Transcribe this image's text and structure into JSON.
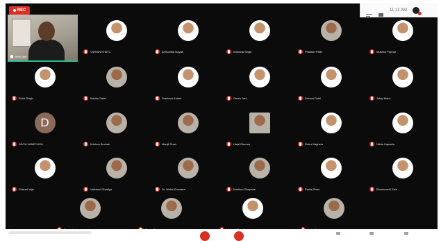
{
  "recording": {
    "label": "REC"
  },
  "header": {
    "time": "11:12 AM",
    "icons": [
      "people-icon",
      "chat-icon"
    ]
  },
  "self_view": {
    "name": "Vidhi Jain"
  },
  "participants": [
    {
      "name": "VIDHAN KHATC",
      "photo": "true"
    },
    {
      "name": "Aniruddha Nayak",
      "photo": "true"
    },
    {
      "name": "Archana Singh",
      "photo": "true"
    },
    {
      "name": "Prakash Patel",
      "photo": "true"
    },
    {
      "name": "Mukesh Parmar",
      "photo": "true"
    },
    {
      "name": "Rohit Singh",
      "photo": "true"
    },
    {
      "name": "Madhu Patel",
      "photo": "true"
    },
    {
      "name": "Sneheva Kulant",
      "photo": "true"
    },
    {
      "name": "Geeta Jani",
      "photo": "true"
    },
    {
      "name": "Dhruva Patel",
      "photo": "true"
    },
    {
      "name": "Jatay Mauv",
      "photo": "true"
    },
    {
      "name": "DIVYA VANECHGLI",
      "letter": "D"
    },
    {
      "name": "Krishna Suchak",
      "photo": "true"
    },
    {
      "name": "Manjil Shah",
      "photo": "true"
    },
    {
      "name": "Hajal Bhensa",
      "photo": "true"
    },
    {
      "name": "Rahul Vaghela",
      "photo": "true"
    },
    {
      "name": "Nikita Kapadia",
      "photo": "true"
    },
    {
      "name": "Sharad Vaja",
      "photo": "true"
    },
    {
      "name": "Vaibhavi Ghadiya",
      "photo": "true"
    },
    {
      "name": "Dr. Nisha Khanana",
      "photo": "true"
    },
    {
      "name": "Madhuri Ghepade",
      "photo": "true"
    },
    {
      "name": "Parita Shah",
      "photo": "true"
    },
    {
      "name": "Bhushanshi Zala",
      "photo": "true"
    },
    {
      "name": "Ruch Jani",
      "photo": "true"
    },
    {
      "name": "Pooja Shah",
      "photo": "true"
    },
    {
      "name": "Mukesh Parmar",
      "photo": "true"
    },
    {
      "name": "Antal Shah",
      "photo": "true"
    }
  ],
  "colors": {
    "mic_muted": "#d93025",
    "stage_bg": "#0b0b0b",
    "active_speaker": "#2ebd8f"
  }
}
